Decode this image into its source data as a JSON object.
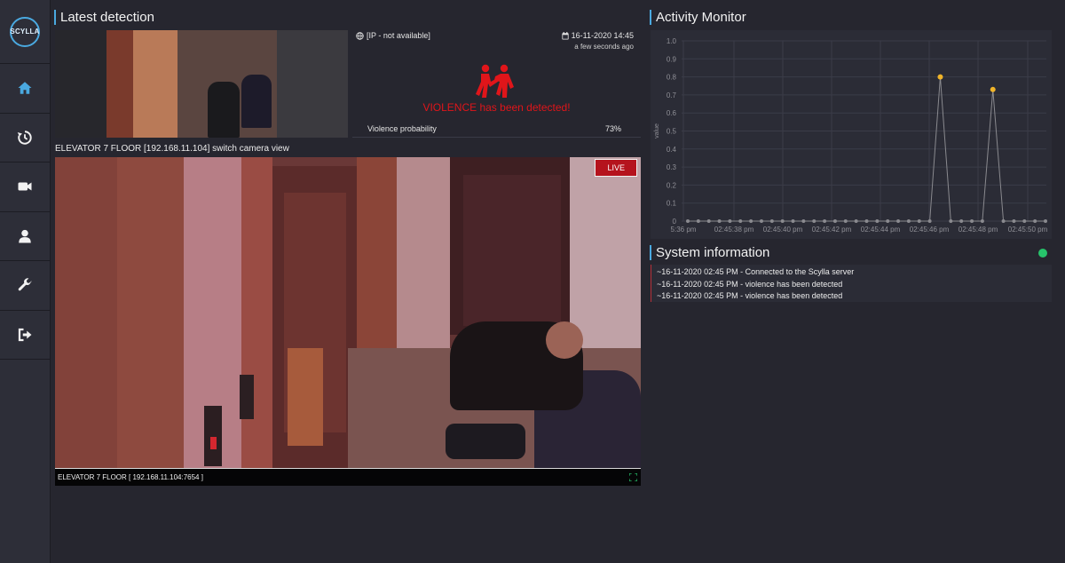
{
  "app": {
    "logo_text": "SCYLLA"
  },
  "sidebar": {
    "items": [
      {
        "name": "home",
        "icon": "home-icon",
        "active": true
      },
      {
        "name": "history",
        "icon": "history-icon",
        "active": false
      },
      {
        "name": "cameras",
        "icon": "video-camera-icon",
        "active": false
      },
      {
        "name": "profile",
        "icon": "user-icon",
        "active": false
      },
      {
        "name": "settings",
        "icon": "wrench-icon",
        "active": false
      },
      {
        "name": "logout",
        "icon": "sign-out-icon",
        "active": false
      }
    ]
  },
  "latest_detection": {
    "title": "Latest detection",
    "ip": "[IP - not available]",
    "date": "16-11-2020 14:45",
    "ago": "a few seconds ago",
    "alert": "VIOLENCE has been detected!",
    "probability_label": "Violence probability",
    "probability_value": "73%",
    "camera_name": "ELEVATOR 7 FLOOR [192.168.11.104]",
    "switch_link": "switch camera view"
  },
  "camera": {
    "live_label": "LIVE",
    "footer_label": "ELEVATOR 7 FLOOR [ 192.168.11.104:7654 ]"
  },
  "activity_monitor": {
    "title": "Activity Monitor"
  },
  "chart_data": {
    "type": "line",
    "ylabel": "value",
    "ylim": [
      0,
      1.0
    ],
    "yticks": [
      "1.0",
      "0.9",
      "0.8",
      "0.7",
      "0.6",
      "0.5",
      "0.4",
      "0.3",
      "0.2",
      "0.1",
      "0"
    ],
    "xtick_labels": [
      "5:36 pm",
      "02:45:38 pm",
      "02:45:40 pm",
      "02:45:42 pm",
      "02:45:44 pm",
      "02:45:46 pm",
      "02:45:48 pm",
      "02:45:50 pm"
    ],
    "values": [
      0,
      0,
      0,
      0,
      0,
      0,
      0,
      0,
      0,
      0,
      0,
      0,
      0,
      0,
      0,
      0,
      0,
      0,
      0,
      0,
      0,
      0,
      0,
      0,
      0.8,
      0,
      0,
      0,
      0,
      0.73,
      0,
      0,
      0,
      0,
      0
    ],
    "colors": {
      "line": "#8a8a8f",
      "zero_point": "#8a8a8f",
      "peak_point": "#f0b429",
      "grid": "#3b3c48"
    }
  },
  "system_information": {
    "title": "System information",
    "status_color": "#27c36b",
    "log": [
      "~16-11-2020 02:45 PM - Connected to the Scylla server",
      "~16-11-2020 02:45 PM - violence has been detected",
      "~16-11-2020 02:45 PM - violence has been detected"
    ]
  }
}
